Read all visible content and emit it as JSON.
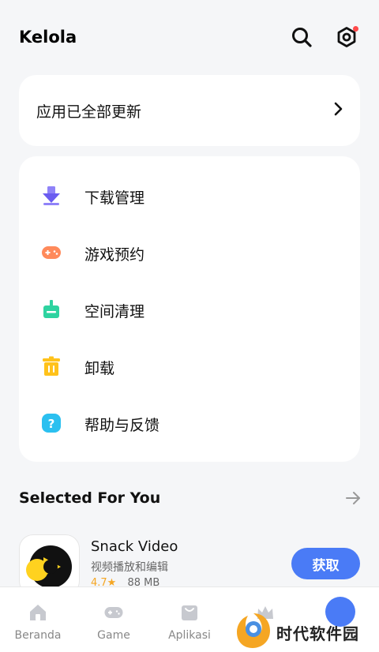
{
  "header": {
    "title": "Kelola",
    "search_icon": "search-icon",
    "settings_icon": "settings-icon",
    "notification_color": "#ff4a4a"
  },
  "update_card": {
    "label": "应用已全部更新",
    "arrow_icon": "chevron-right-icon"
  },
  "menu": {
    "items": [
      {
        "label": "下载管理",
        "icon": "download-icon",
        "color": "#7b6cf6"
      },
      {
        "label": "游戏预约",
        "icon": "gamepad-icon",
        "color": "#ff8a5b"
      },
      {
        "label": "空间清理",
        "icon": "broom-icon",
        "color": "#2ed3a0"
      },
      {
        "label": "卸载",
        "icon": "trash-icon",
        "color": "#ffc21a"
      },
      {
        "label": "帮助与反馈",
        "icon": "help-icon",
        "color": "#2bc0f0"
      }
    ]
  },
  "selected": {
    "title": "Selected For You",
    "arrow_icon": "arrow-right-icon",
    "app": {
      "name": "Snack Video",
      "description": "视频播放和编辑",
      "rating": "4.7★",
      "size": "88 MB",
      "button": "获取",
      "button_color": "#4a7bf6"
    }
  },
  "bottom_nav": {
    "items": [
      {
        "label": "Beranda",
        "icon": "home-icon"
      },
      {
        "label": "Game",
        "icon": "gamepad-icon"
      },
      {
        "label": "Aplikasi",
        "icon": "bag-icon"
      },
      {
        "label": "",
        "icon": "crown-icon"
      },
      {
        "label": "",
        "icon": "manage-icon"
      }
    ]
  },
  "watermark": {
    "text": "时代软件园"
  }
}
